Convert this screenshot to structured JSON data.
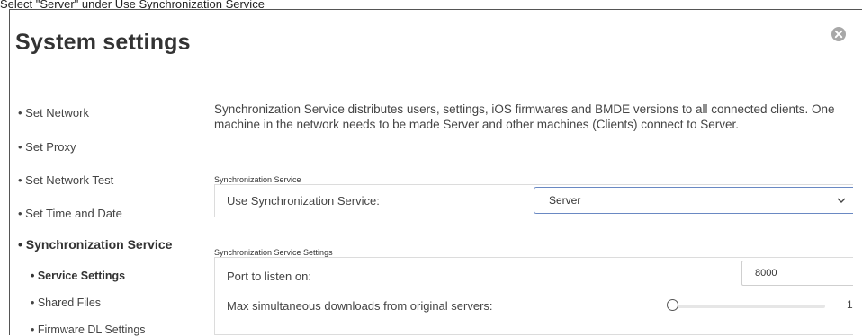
{
  "caption": "Select \"Server\" under Use Synchronization Service",
  "dialog": {
    "title": "System settings",
    "close_icon": "close-circle-icon"
  },
  "sidebar": {
    "items": [
      {
        "label": "• Set Network"
      },
      {
        "label": "• Set Proxy"
      },
      {
        "label": "• Set Network Test"
      },
      {
        "label": "• Set Time and Date"
      },
      {
        "label": "• Synchronization Service",
        "active": true
      }
    ],
    "subitems": [
      {
        "label": "• Service Settings",
        "active": true
      },
      {
        "label": "• Shared Files"
      },
      {
        "label": "• Firmware DL Settings"
      }
    ]
  },
  "main": {
    "description": "Synchronization Service distributes users, settings, iOS firmwares and BMDE versions to all connected clients. One machine in the network needs to be made Server and other machines (Clients) connect to Server.",
    "sync_section": {
      "header": "Synchronization Service",
      "use_label": "Use Synchronization Service:",
      "use_value": "Server"
    },
    "settings_section": {
      "header": "Synchronization Service Settings",
      "port_label": "Port to listen on:",
      "port_value": "8000",
      "max_downloads_label": "Max simultaneous downloads from original servers:",
      "max_downloads_value": "1"
    }
  },
  "colors": {
    "select_border": "#6a89c3",
    "text": "#444444"
  }
}
